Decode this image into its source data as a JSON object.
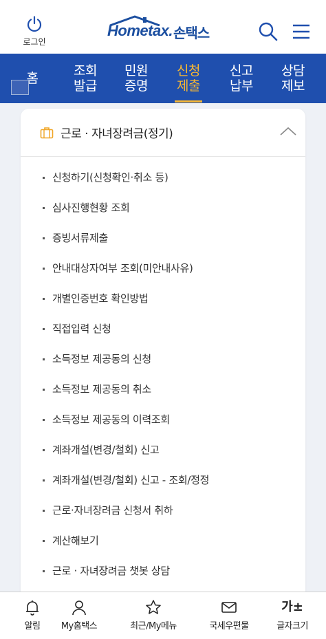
{
  "header": {
    "login_label": "로그인",
    "logo_en": "Hometax.",
    "logo_ko": "손택스"
  },
  "nav": {
    "items": [
      {
        "label": "홈"
      },
      {
        "label": "조회\n발급"
      },
      {
        "label": "민원\n증명"
      },
      {
        "label": "신청\n제출",
        "active": true
      },
      {
        "label": "신고\n납부"
      },
      {
        "label": "상담\n제보"
      }
    ]
  },
  "card": {
    "title": "근로 · 자녀장려금(정기)",
    "items": [
      "신청하기(신청확인·취소 등)",
      "심사진행현황 조회",
      "증빙서류제출",
      "안내대상자여부 조회(미안내사유)",
      "개별인증번호 확인방법",
      "직접입력 신청",
      "소득정보 제공동의 신청",
      "소득정보 제공동의 취소",
      "소득정보 제공동의 이력조회",
      "계좌개설(변경/철회) 신고",
      "계좌개설(변경/철회) 신고 - 조회/정정",
      "근로·자녀장려금 신청서 취하",
      "계산해보기",
      "근로 · 자녀장려금 챗봇 상담"
    ]
  },
  "bottom_bar": {
    "tabs": [
      {
        "label": "알림",
        "icon": "bell-icon"
      },
      {
        "label": "My홈택스",
        "icon": "person-icon"
      },
      {
        "label": "최근/My메뉴",
        "icon": "star-icon"
      },
      {
        "label": "국세우편물",
        "icon": "mail-icon"
      },
      {
        "label": "글자크기",
        "icon": "font-size-icon",
        "glyph": "가±"
      }
    ]
  },
  "colors": {
    "brand_blue": "#1f4fae",
    "accent_orange": "#f7b733",
    "logo_blue": "#1c4fa0"
  }
}
